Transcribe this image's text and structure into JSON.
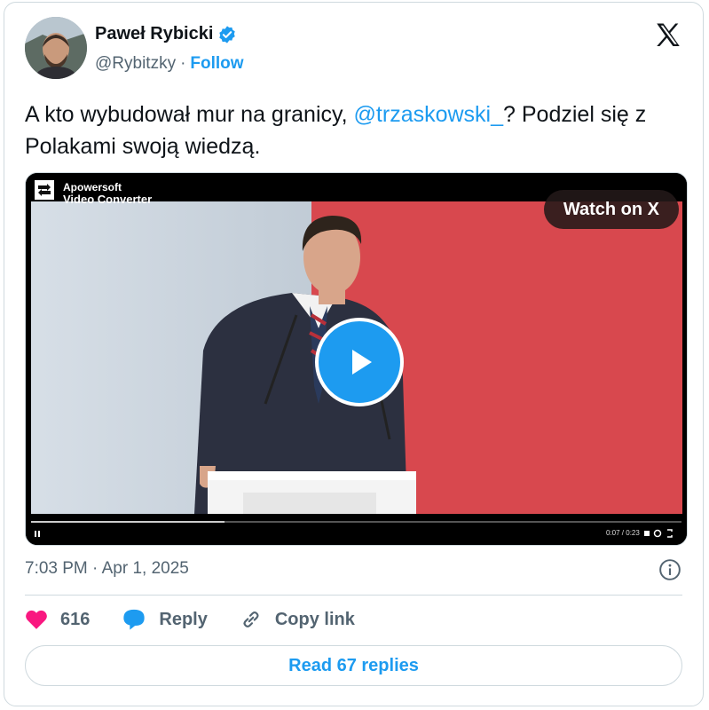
{
  "author": {
    "name": "Paweł Rybicki",
    "handle": "@Rybitzky",
    "separator": "·",
    "follow_label": "Follow"
  },
  "tweet": {
    "text_before": "A kto wybudował mur na granicy, ",
    "mention": "@trzaskowski_",
    "text_after": "? Podziel się z Polakami swoją wiedzą."
  },
  "media": {
    "watermark_line1": "Apowersoft",
    "watermark_line2": "Video Converter",
    "watch_label": "Watch on X",
    "time_display": "0:07 / 0:23"
  },
  "meta": {
    "timestamp": "7:03 PM · Apr 1, 2025"
  },
  "actions": {
    "like_count": "616",
    "reply_label": "Reply",
    "copy_link_label": "Copy link"
  },
  "read_replies_label": "Read 67 replies",
  "colors": {
    "accent": "#1d9bf0",
    "like": "#f91880",
    "text": "#0f1419",
    "muted": "#536471"
  }
}
